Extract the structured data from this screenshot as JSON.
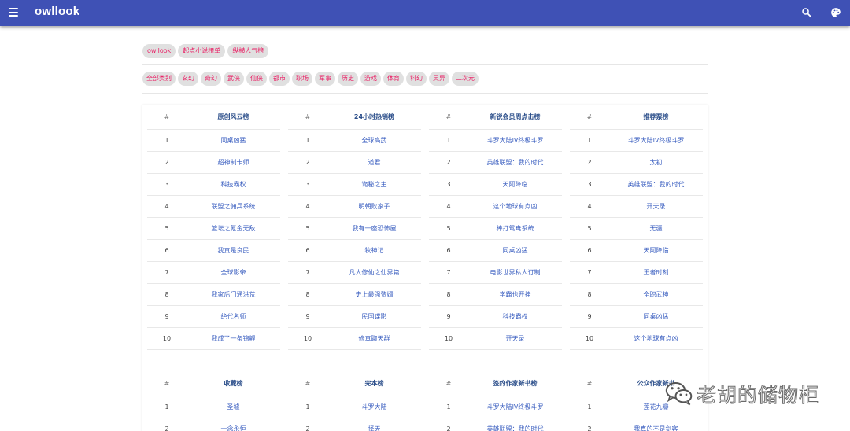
{
  "appbar": {
    "title": "owllook",
    "bg_color": "#3f51b5"
  },
  "nav_chips": [
    "owllook",
    "起点小说榜单",
    "纵横人气榜"
  ],
  "category_chips": [
    "全部类别",
    "玄幻",
    "奇幻",
    "武侠",
    "仙侠",
    "都市",
    "职场",
    "军事",
    "历史",
    "游戏",
    "体育",
    "科幻",
    "灵异",
    "二次元"
  ],
  "chip_text_color": "#e91e63",
  "rankings": [
    {
      "num_header": "#",
      "title": "原创风云榜",
      "items": [
        "同桌凶猛",
        "超神制卡师",
        "科技霸权",
        "联盟之佣兵系统",
        "篮坛之氪金无敌",
        "我真是良民",
        "全球影帝",
        "我家后门通洪荒",
        "绝代名师",
        "我成了一条锦鲤"
      ]
    },
    {
      "num_header": "#",
      "title": "24小时热销榜",
      "items": [
        "全球高武",
        "道君",
        "诡秘之主",
        "明朝败家子",
        "我有一座恐怖屋",
        "牧神记",
        "凡人修仙之仙界篇",
        "史上最强赘婿",
        "民国谍影",
        "修真聊天群"
      ]
    },
    {
      "num_header": "#",
      "title": "新锐会员周点击榜",
      "items": [
        "斗罗大陆IV终极斗罗",
        "英雄联盟：我的时代",
        "天阿降临",
        "这个地球有点凶",
        "棒打鸳鸯系统",
        "同桌凶猛",
        "电影世界私人订制",
        "学霸也开挂",
        "科技霸权",
        "开天录"
      ]
    },
    {
      "num_header": "#",
      "title": "推荐票榜",
      "items": [
        "斗罗大陆IV终极斗罗",
        "太初",
        "英雄联盟：我的时代",
        "开天录",
        "无疆",
        "天阿降临",
        "王者时刻",
        "全职武神",
        "同桌凶猛",
        "这个地球有点凶"
      ]
    },
    {
      "num_header": "#",
      "title": "收藏榜",
      "items": [
        "圣墟",
        "一念永恒"
      ]
    },
    {
      "num_header": "#",
      "title": "完本榜",
      "items": [
        "斗罗大陆",
        "择天"
      ]
    },
    {
      "num_header": "#",
      "title": "签约作家新书榜",
      "items": [
        "斗罗大陆IV终极斗罗",
        "英雄联盟：我的时代"
      ]
    },
    {
      "num_header": "#",
      "title": "公众作家新书",
      "items": [
        "莲花九瓣",
        "我真的不是剑客"
      ]
    }
  ],
  "watermark": {
    "text": "老胡的储物柜",
    "logo_icon": "wechat-logo-icon"
  }
}
